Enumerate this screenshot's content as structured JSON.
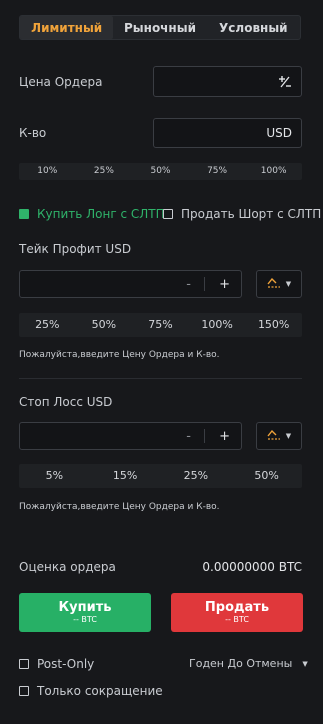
{
  "tabs": [
    "Лимитный",
    "Рыночный",
    "Условный"
  ],
  "active_tab": 0,
  "order_price": {
    "label": "Цена Ордера",
    "value": ""
  },
  "qty": {
    "label": "К-во",
    "unit": "USD",
    "value": ""
  },
  "qty_percents": [
    "10%",
    "25%",
    "50%",
    "75%",
    "100%"
  ],
  "checks": {
    "buy_long": {
      "label": "Купить Лонг с СЛТП",
      "checked": true
    },
    "sell_short": {
      "label": "Продать Шорт с СЛТП",
      "checked": false
    }
  },
  "take_profit": {
    "label": "Тейк Профит USD",
    "minus": "-",
    "plus": "+",
    "percents": [
      "25%",
      "50%",
      "75%",
      "100%",
      "150%"
    ],
    "hint": "Пожалуйста,введите Цену Ордера и К-во."
  },
  "stop_loss": {
    "label": "Стоп Лосс  USD",
    "minus": "-",
    "plus": "+",
    "percents": [
      "5%",
      "15%",
      "25%",
      "50%"
    ],
    "hint": "Пожалуйста,введите Цену Ордера и К-во."
  },
  "estimate": {
    "label": "Оценка ордера",
    "value": "0.00000000 BTC"
  },
  "buy_button": {
    "label": "Купить",
    "sub": "-- BTC"
  },
  "sell_button": {
    "label": "Продать",
    "sub": "-- BTC"
  },
  "post_only": {
    "label": "Post-Only",
    "checked": false
  },
  "reduce_only": {
    "label": "Только сокращение",
    "checked": false
  },
  "tif": {
    "value": "Годен До Отмены"
  },
  "colors": {
    "accent": "#f0a33a",
    "buy": "#27b066",
    "sell": "#e0383b",
    "background": "#17181b"
  }
}
